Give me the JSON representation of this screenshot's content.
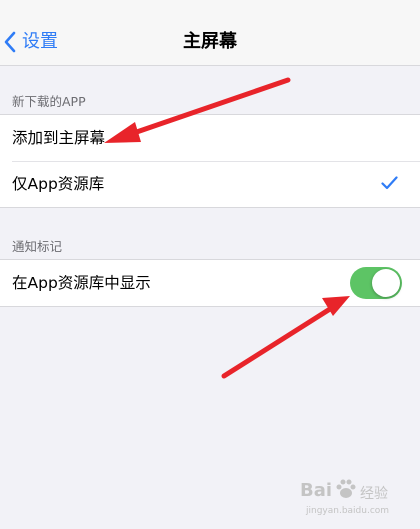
{
  "nav": {
    "back_label": "设置",
    "title": "主屏幕"
  },
  "sections": [
    {
      "header": "新下载的APP",
      "rows": [
        {
          "label": "添加到主屏幕",
          "selected": false
        },
        {
          "label": "仅App资源库",
          "selected": true
        }
      ]
    },
    {
      "header": "通知标记",
      "rows": [
        {
          "label": "在App资源库中显示",
          "toggle_on": true
        }
      ]
    }
  ],
  "watermark": {
    "brand": "Bai",
    "brand_suffix": "经验",
    "url": "jingyan.baidu.com"
  },
  "colors": {
    "accent": "#2f7cf6",
    "toggle_on": "#5dc465",
    "annotation_arrow": "#e8242a",
    "background": "#f2f2f7"
  }
}
